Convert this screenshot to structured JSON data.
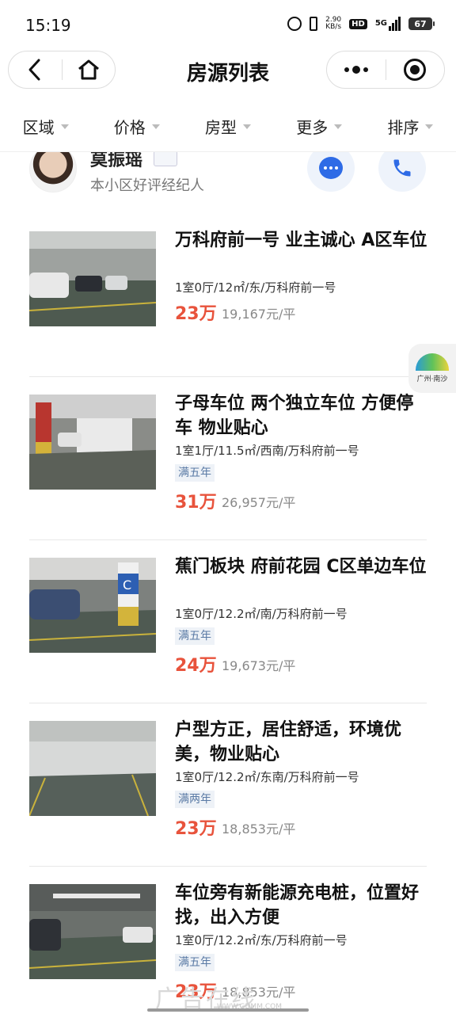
{
  "status_bar": {
    "time": "15:19",
    "speed_value": "2.90",
    "speed_unit": "KB/s",
    "hd": "HD",
    "network": "5G",
    "battery": "67"
  },
  "nav": {
    "title": "房源列表",
    "back_icon": "chevron-left-icon",
    "home_icon": "home-icon",
    "more_icon": "more-dots-icon",
    "close_icon": "target-icon"
  },
  "filters": [
    {
      "label": "区域"
    },
    {
      "label": "价格"
    },
    {
      "label": "房型"
    },
    {
      "label": "更多"
    },
    {
      "label": "排序"
    }
  ],
  "agent": {
    "name": "莫振瑶",
    "subtitle": "本小区好评经纪人"
  },
  "listings": [
    {
      "title": "万科府前一号 业主诚心 A区车位",
      "meta": "1室0厅/12㎡/东/万科府前一号",
      "tag": "",
      "price": "23万",
      "unit_price": "19,167元/平"
    },
    {
      "title": "子母车位 两个独立车位 方便停车 物业贴心",
      "meta": "1室1厅/11.5㎡/西南/万科府前一号",
      "tag": "满五年",
      "price": "31万",
      "unit_price": "26,957元/平"
    },
    {
      "title": "蕉门板块 府前花园 C区单边车位",
      "meta": "1室0厅/12.2㎡/南/万科府前一号",
      "tag": "满五年",
      "price": "24万",
      "unit_price": "19,673元/平"
    },
    {
      "title": "户型方正，居住舒适，环境优美，物业贴心",
      "meta": "1室0厅/12.2㎡/东南/万科府前一号",
      "tag": "满两年",
      "price": "23万",
      "unit_price": "18,853元/平"
    },
    {
      "title": "车位旁有新能源充电桩，位置好找，出入方便",
      "meta": "1室0厅/12.2㎡/东/万科府前一号",
      "tag": "满五年",
      "price": "23万",
      "unit_price": "18,853元/平"
    }
  ],
  "float_badge": {
    "label": "广州·南沙"
  },
  "watermark": {
    "text": "广告在线",
    "url": "WWW.GDMM.COM"
  },
  "colors": {
    "price": "#e8533c",
    "accent": "#2e6be6",
    "tag_text": "#5a7aa5"
  }
}
